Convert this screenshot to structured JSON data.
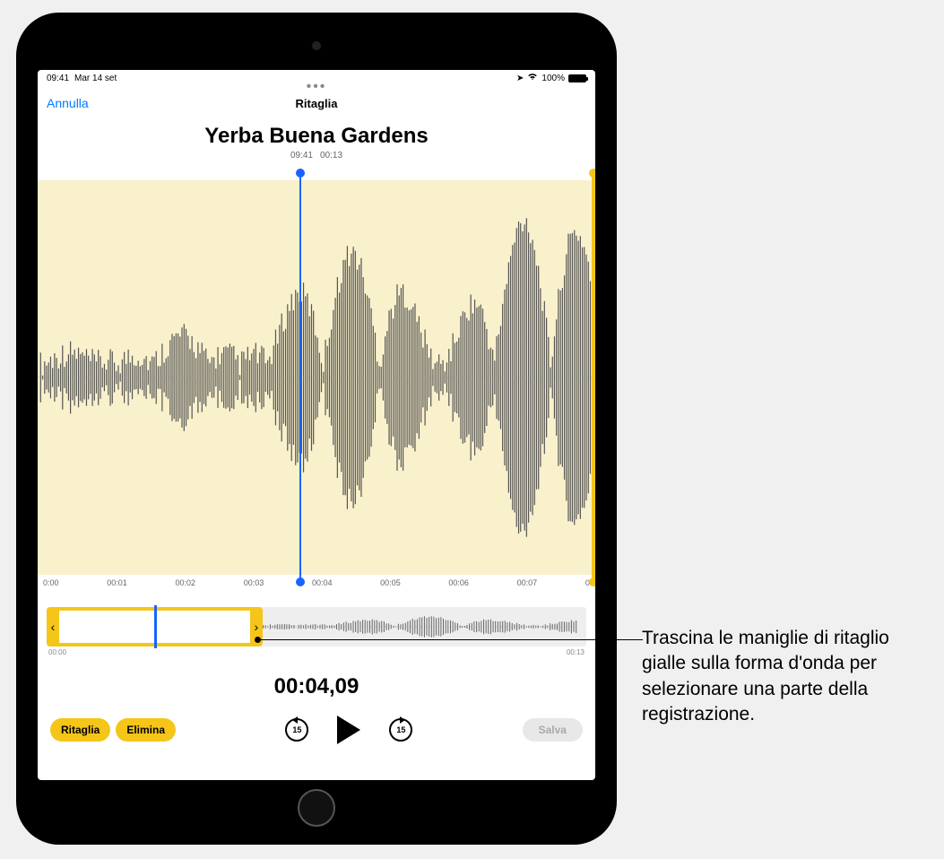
{
  "status": {
    "time": "09:41",
    "date": "Mar 14 set",
    "battery_text": "100%"
  },
  "nav": {
    "cancel": "Annulla",
    "title": "Ritaglia"
  },
  "recording": {
    "title": "Yerba Buena Gardens",
    "created_time": "09:41",
    "duration": "00:13"
  },
  "ticks": {
    "labels": [
      "0:00",
      "00:01",
      "00:02",
      "00:03",
      "00:04",
      "00:05",
      "00:06",
      "00:07",
      "0"
    ]
  },
  "overview": {
    "start_label": "00:00",
    "end_label": "00:13",
    "selection_start_pct": 0,
    "selection_end_pct": 40,
    "playhead_pct": 20
  },
  "main": {
    "playhead_pct": 47
  },
  "time_display": "00:04,09",
  "buttons": {
    "trim": "Ritaglia",
    "delete": "Elimina",
    "save": "Salva",
    "skip_amount": "15"
  },
  "callout": {
    "text": "Trascina le maniglie di ritaglio gialle sulla forma d'onda per selezionare una parte della registrazione."
  },
  "colors": {
    "accent_yellow": "#f5c518",
    "playhead_blue": "#1964ff",
    "wave_bg": "#f9f0cc"
  }
}
